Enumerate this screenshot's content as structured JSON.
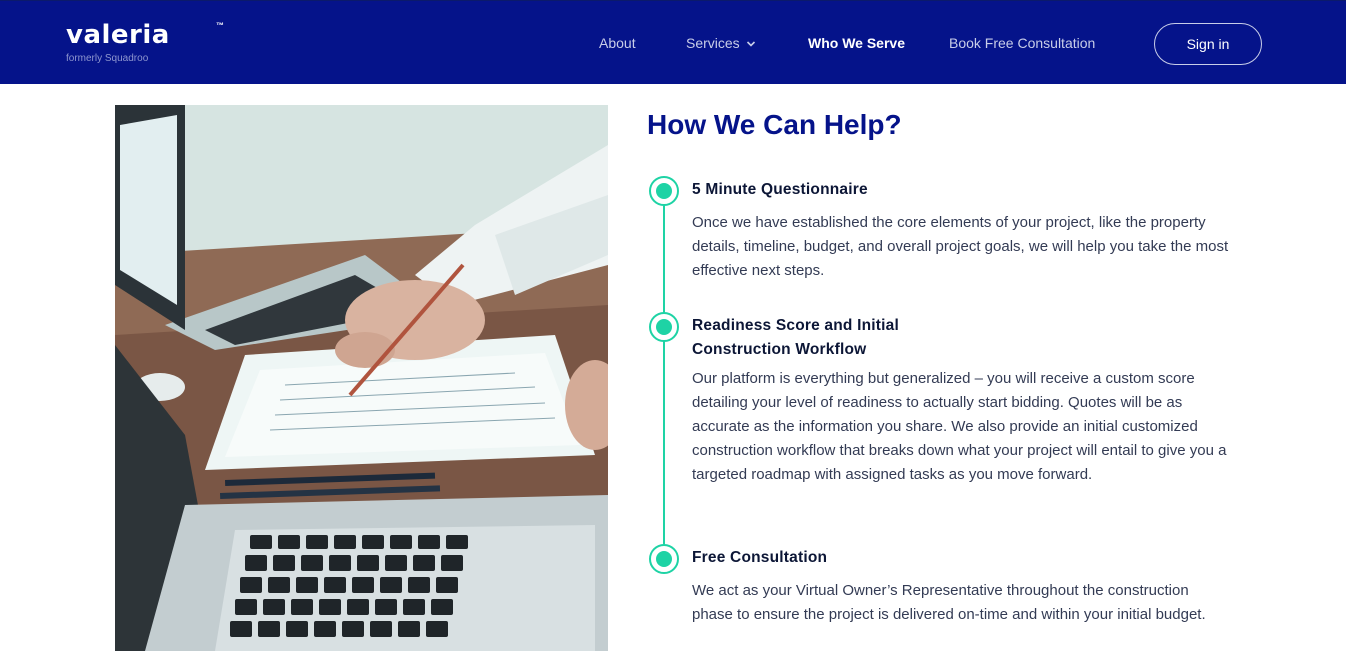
{
  "header": {
    "logo_text": "valeria",
    "logo_tm": "™",
    "logo_subtitle": "formerly Squadroo",
    "nav": {
      "about": "About",
      "services": "Services",
      "who_we_serve": "Who We Serve",
      "book": "Book Free Consultation"
    },
    "signin_label": "Sign in"
  },
  "main": {
    "heading": "How We Can Help?",
    "steps": [
      {
        "title": "5 Minute Questionnaire",
        "body": "Once we have established the core elements of your project, like the property details, timeline, budget, and overall project goals, we will help you take the most effective next steps."
      },
      {
        "title": "Readiness Score and Initial Construction Workflow",
        "body": "Our platform is everything but generalized – you will receive a custom score detailing your level of readiness to actually start bidding. Quotes will be as accurate as the information you share. We also provide an initial customized construction workflow that breaks down what your project will entail to give you a targeted roadmap with assigned tasks as you move forward."
      },
      {
        "title": "Free Consultation",
        "body": "We act as your Virtual Owner’s Representative throughout the construction phase to ensure the project is delivered on-time and within your initial budget."
      }
    ]
  },
  "colors": {
    "header_bg": "#05138a",
    "accent": "#1ed3a5",
    "heading": "#05138a"
  }
}
